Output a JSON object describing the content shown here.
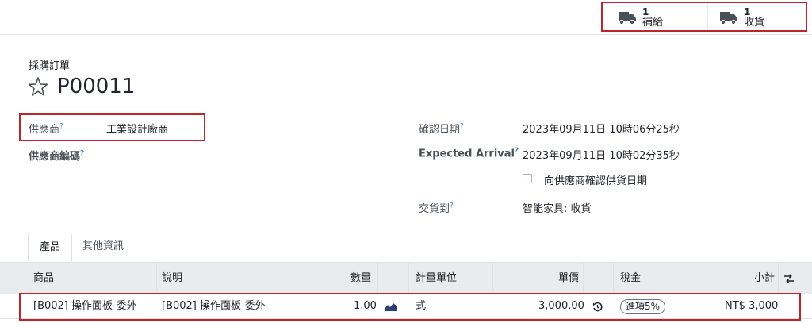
{
  "smart_buttons": [
    {
      "count": "1",
      "label": "補給",
      "icon": "truck-icon"
    },
    {
      "count": "1",
      "label": "收貨",
      "icon": "truck-icon"
    }
  ],
  "document": {
    "type_label": "採購訂單",
    "name": "P00011"
  },
  "fields": {
    "vendor": {
      "label": "供應商",
      "help": "?",
      "value": "工業設計廠商"
    },
    "vendor_ref": {
      "label": "供應商編碼",
      "help": "?"
    },
    "confirm_date": {
      "label": "確認日期",
      "help": "?",
      "value": "2023年09月11日 10時06分25秒"
    },
    "expected_arrival": {
      "label": "Expected Arrival",
      "help": "?",
      "value": "2023年09月11日 10時02分35秒"
    },
    "ask_confirm": {
      "label": "向供應商確認供貨日期"
    },
    "deliver_to": {
      "label": "交貨到",
      "help": "?",
      "value": "智能家具: 收貨"
    }
  },
  "tabs": [
    {
      "label": "產品"
    },
    {
      "label": "其他資訊"
    }
  ],
  "table": {
    "columns": [
      "商品",
      "說明",
      "數量",
      "計量單位",
      "單價",
      "稅金",
      "小計"
    ],
    "rows": [
      {
        "product": "[B002] 操作面板-委外",
        "description": "[B002] 操作面板-委外",
        "qty": "1.00",
        "uom": "式",
        "price": "3,000.00",
        "tax": "進項5%",
        "subtotal": "NT$ 3,000"
      }
    ]
  },
  "colors": {
    "highlight": "#c0242b",
    "header_bg": "#e9ecef",
    "help": "#3b86c4"
  }
}
